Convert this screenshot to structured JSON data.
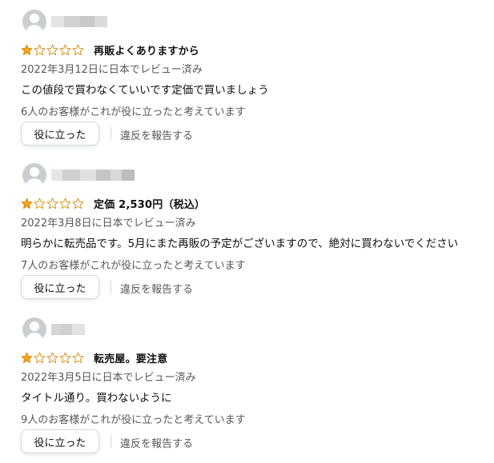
{
  "colors": {
    "star_fill": "#f4a41d",
    "star_outline": "#d38b0f",
    "secondary_text": "#565959",
    "primary_text": "#0f1111",
    "button_border": "#d5d9d9"
  },
  "reviews": [
    {
      "rating": 1,
      "max_rating": 5,
      "title": "再販よくありますから",
      "date": "2022年3月12日に日本でレビュー済み",
      "body": "この値段で買わなくていいです定価で買いましょう",
      "helpful_count_text": "6人のお客様がこれが役に立ったと考えています",
      "helpful_button": "役に立った",
      "report_link": "違反を報告する"
    },
    {
      "rating": 1,
      "max_rating": 5,
      "title": "定価 2,530円（税込）",
      "date": "2022年3月8日に日本でレビュー済み",
      "body": "明らかに転売品です。5月にまた再販の予定がございますので、絶対に買わないでください",
      "helpful_count_text": "7人のお客様がこれが役に立ったと考えています",
      "helpful_button": "役に立った",
      "report_link": "違反を報告する"
    },
    {
      "rating": 1,
      "max_rating": 5,
      "title": "転売屋。要注意",
      "date": "2022年3月5日に日本でレビュー済み",
      "body": "タイトル通り。買わないように",
      "helpful_count_text": "9人のお客様がこれが役に立ったと考えています",
      "helpful_button": "役に立った",
      "report_link": "違反を報告する"
    }
  ]
}
